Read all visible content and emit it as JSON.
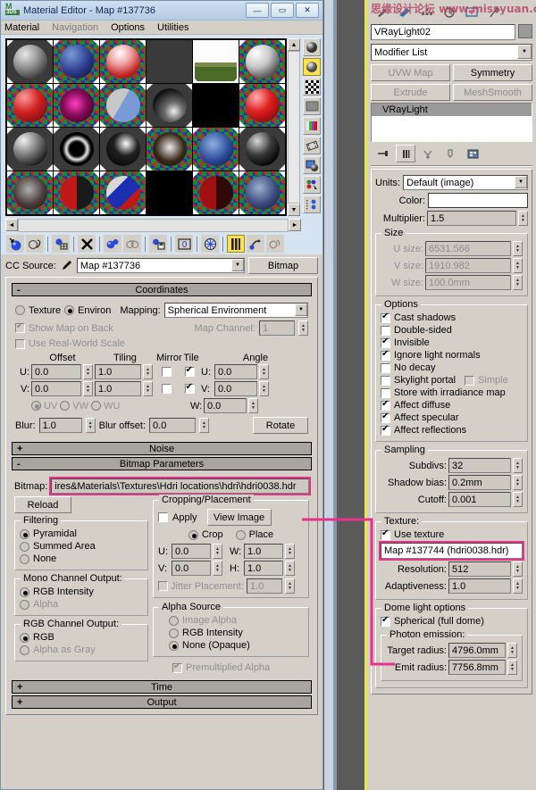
{
  "window": {
    "title": "Material Editor - Map #137736",
    "logo_top": "M",
    "logo_bottom": "3DS",
    "minimize": "—",
    "maximize": "▭",
    "close": "✕"
  },
  "menu": {
    "items": [
      "Material",
      "Navigation",
      "Options",
      "Utilities"
    ]
  },
  "slot_grid": {
    "rows": 4,
    "cols": 6,
    "selected_index": 4,
    "scroll_up": "▲",
    "scroll_down": "▼",
    "scroll_left": "◄",
    "scroll_right": "►"
  },
  "vertical_toolbar": {
    "items": [
      {
        "name": "sample-type-icon",
        "active": false
      },
      {
        "name": "backlight-icon",
        "active": true
      },
      {
        "name": "background-checker-icon",
        "active": false
      },
      {
        "name": "sample-uv-tiling-icon",
        "active": false
      },
      {
        "name": "video-color-check-icon",
        "active": false
      },
      {
        "name": "make-preview-icon",
        "active": false
      },
      {
        "name": "options-icon",
        "active": false
      },
      {
        "name": "select-by-material-icon",
        "active": false
      },
      {
        "name": "material-id-channel-icon",
        "active": false
      }
    ]
  },
  "horizontal_toolbar": {
    "items": [
      "get-material-icon",
      "put-material-to-scene-icon",
      "assign-material-icon",
      "reset-map-icon",
      "make-material-copy-icon",
      "make-unique-icon",
      "put-to-library-icon",
      "material-effects-id-icon",
      "show-in-viewport-icon",
      "show-end-result-icon",
      "go-to-parent-icon",
      "go-forward-sibling-icon"
    ],
    "active_index": 9
  },
  "source_row": {
    "label": "CC Source:",
    "eyedropper_icon": "eyedropper-icon",
    "map_name": "Map #137736",
    "type_button": "Bitmap"
  },
  "coordinates": {
    "rollout_label": "Coordinates",
    "rollout_state": "-",
    "texture_label": "Texture",
    "texture_selected": false,
    "environ_label": "Environ",
    "environ_selected": true,
    "mapping_label": "Mapping:",
    "mapping_value": "Spherical Environment",
    "show_map_on_back_label": "Show Map on Back",
    "show_map_on_back_checked": true,
    "map_channel_label": "Map Channel:",
    "map_channel_value": "1",
    "use_real_world_scale_label": "Use Real-World Scale",
    "use_real_world_scale_checked": false,
    "col_offset": "Offset",
    "col_tiling": "Tiling",
    "col_mirror": "Mirror",
    "col_tile": "Tile",
    "col_angle": "Angle",
    "u_label": "U:",
    "v_label": "V:",
    "w_label": "W:",
    "offset_u": "0.0",
    "offset_v": "0.0",
    "tiling_u": "1.0",
    "tiling_v": "1.0",
    "mirror_u": false,
    "mirror_v": false,
    "tile_u": true,
    "tile_v": true,
    "angle_u": "0.0",
    "angle_v": "0.0",
    "angle_w": "0.0",
    "uv_label": "UV",
    "vw_label": "VW",
    "wu_label": "WU",
    "uv_selected": true,
    "blur_label": "Blur:",
    "blur_value": "1.0",
    "blur_offset_label": "Blur offset:",
    "blur_offset_value": "0.0",
    "rotate_button": "Rotate"
  },
  "noise": {
    "rollout_label": "Noise",
    "rollout_state": "+"
  },
  "bitmap_parameters": {
    "rollout_label": "Bitmap Parameters",
    "rollout_state": "-",
    "bitmap_label": "Bitmap:",
    "bitmap_path": "ires&Materials\\Textures\\Hdri locations\\hdri\\hdri0038.hdr",
    "reload_button": "Reload",
    "filtering": {
      "title": "Filtering",
      "options": [
        "Pyramidal",
        "Summed Area",
        "None"
      ],
      "selected": 0
    },
    "mono_channel_output": {
      "title": "Mono Channel Output:",
      "options": [
        "RGB Intensity",
        "Alpha"
      ],
      "selected": 0,
      "disabled": [
        false,
        true
      ]
    },
    "rgb_channel_output": {
      "title": "RGB Channel Output:",
      "options": [
        "RGB",
        "Alpha as Gray"
      ],
      "selected": 0,
      "disabled": [
        false,
        true
      ]
    },
    "cropping": {
      "title": "Cropping/Placement",
      "apply_label": "Apply",
      "apply_checked": false,
      "view_image_button": "View Image",
      "crop_label": "Crop",
      "place_label": "Place",
      "crop_selected": true,
      "u_label": "U:",
      "u_value": "0.0",
      "v_label": "V:",
      "v_value": "0.0",
      "w_label": "W:",
      "w_value": "1.0",
      "h_label": "H:",
      "h_value": "1.0",
      "jitter_label": "Jitter Placement:",
      "jitter_checked": false,
      "jitter_value": "1.0"
    },
    "alpha_source": {
      "title": "Alpha Source",
      "options": [
        "Image Alpha",
        "RGB Intensity",
        "None (Opaque)"
      ],
      "selected": 2,
      "disabled": [
        true,
        false,
        false
      ],
      "premultiplied_label": "Premultiplied Alpha",
      "premultiplied_checked": true
    }
  },
  "time_rollout": {
    "rollout_label": "Time",
    "rollout_state": "+"
  },
  "output_rollout": {
    "rollout_label": "Output",
    "rollout_state": "+"
  },
  "command_panel": {
    "watermark": "思缘设计论坛 www.missyuan.com",
    "icons": [
      "create-icon",
      "modify-icon",
      "hierarchy-icon",
      "motion-icon",
      "display-icon",
      "utilities-icon"
    ],
    "object_name": "VRayLight02",
    "modifier_list_label": "Modifier List",
    "modifier_buttons": [
      {
        "label": "UVW Map",
        "disabled": true
      },
      {
        "label": "Symmetry",
        "disabled": false
      },
      {
        "label": "Extrude",
        "disabled": true
      },
      {
        "label": "MeshSmooth",
        "disabled": true
      }
    ],
    "stack_items": [
      "VRayLight"
    ],
    "stack_tools": [
      "pin-stack-icon",
      "show-end-result-icon",
      "make-unique-icon",
      "remove-modifier-icon",
      "configure-sets-icon"
    ],
    "units": {
      "label": "Units:",
      "value": "Default (image)"
    },
    "color": {
      "label": "Color:",
      "value": "#ffffff"
    },
    "multiplier": {
      "label": "Multiplier:",
      "value": "1.5"
    },
    "size": {
      "title": "Size",
      "u_label": "U size:",
      "u_value": "6531.566",
      "v_label": "V size:",
      "v_value": "1910.982",
      "w_label": "W size:",
      "w_value": "100.0mm"
    },
    "options": {
      "title": "Options",
      "items": [
        {
          "label": "Cast shadows",
          "checked": true
        },
        {
          "label": "Double-sided",
          "checked": false
        },
        {
          "label": "Invisible",
          "checked": true
        },
        {
          "label": "Ignore light normals",
          "checked": true
        },
        {
          "label": "No decay",
          "checked": false
        },
        {
          "label": "Skylight portal",
          "checked": false
        },
        {
          "label": "Store with irradiance map",
          "checked": false
        },
        {
          "label": "Affect diffuse",
          "checked": true
        },
        {
          "label": "Affect specular",
          "checked": true
        },
        {
          "label": "Affect reflections",
          "checked": true
        }
      ],
      "simple_label": "Simple",
      "simple_checked": false
    },
    "sampling": {
      "title": "Sampling",
      "subdivs_label": "Subdivs:",
      "subdivs_value": "32",
      "shadow_bias_label": "Shadow bias:",
      "shadow_bias_value": "0.2mm",
      "cutoff_label": "Cutoff:",
      "cutoff_value": "0.001"
    },
    "texture": {
      "title": "Texture:",
      "use_texture_label": "Use texture",
      "use_texture_checked": true,
      "map_button": "Map #137744 (hdri0038.hdr)",
      "resolution_label": "Resolution:",
      "resolution_value": "512",
      "adaptiveness_label": "Adaptiveness:",
      "adaptiveness_value": "1.0"
    },
    "dome_light": {
      "title": "Dome light options",
      "spherical_label": "Spherical (full dome)",
      "spherical_checked": true
    },
    "photon_emission": {
      "title": "Photon emission:",
      "target_radius_label": "Target radius:",
      "target_radius_value": "4796.0mm",
      "emit_radius_label": "Emit radius:",
      "emit_radius_value": "7756.8mm"
    }
  },
  "annotation": {
    "color": "#e8318c"
  }
}
